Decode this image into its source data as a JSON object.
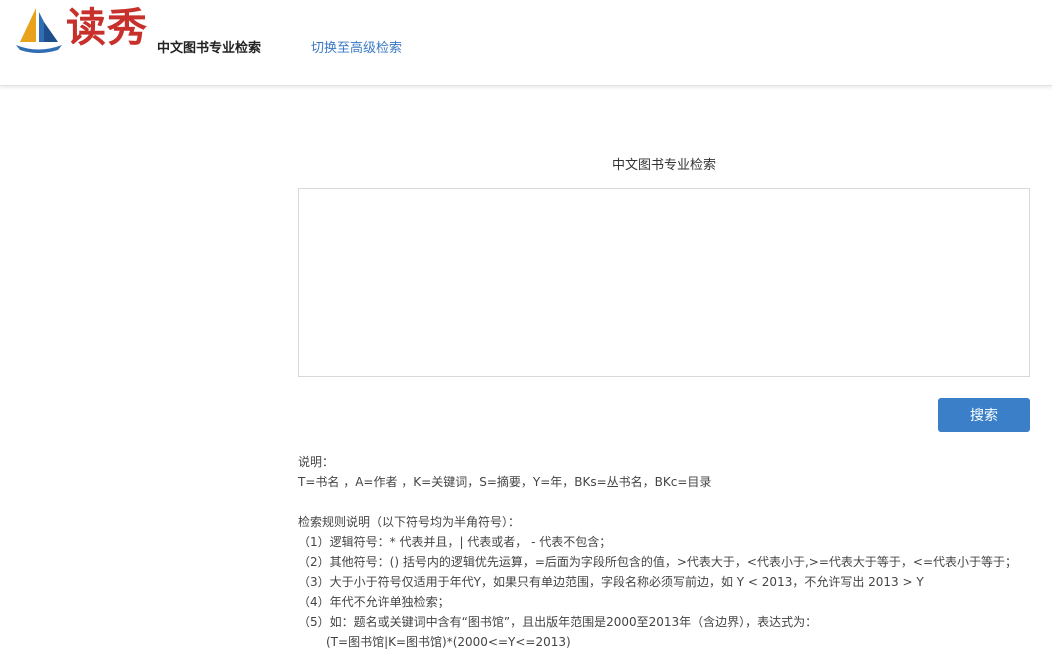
{
  "header": {
    "logo_text": "读秀",
    "title": "中文图书专业检索",
    "switch_link": "切换至高级检索"
  },
  "main": {
    "title": "中文图书专业检索",
    "query_value": "",
    "search_button": "搜索"
  },
  "notes": {
    "heading": "说明：",
    "fields": "T=书名 ，A=作者 ，K=关键词，S=摘要，Y=年，BKs=丛书名，BKc=目录",
    "rules_heading": "检索规则说明（以下符号均为半角符号）：",
    "rules": [
      "（1）逻辑符号：* 代表并且，| 代表或者， - 代表不包含；",
      "（2）其他符号：() 括号内的逻辑优先运算，=后面为字段所包含的值，>代表大于，<代表小于,>=代表大于等于，<=代表小于等于；",
      "（3）大于小于符号仅适用于年代Y，如果只有单边范围，字段名称必须写前边，如 Y < 2013，不允许写出 2013 > Y",
      "（4）年代不允许单独检索；",
      "（5）如：题名或关键词中含有“图书馆”，且出版年范围是2000至2013年（含边界），表达式为："
    ],
    "example": "(T=图书馆|K=图书馆)*(2000<=Y<=2013)"
  },
  "colors": {
    "accent": "#3a7fc8",
    "link": "#3a78c3",
    "logo_red": "#c8302c"
  }
}
